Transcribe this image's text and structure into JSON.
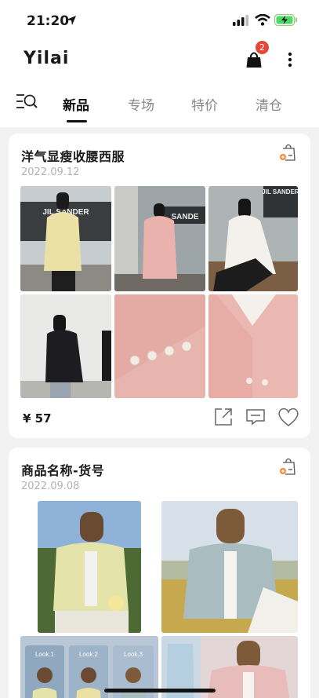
{
  "status": {
    "time": "21:20"
  },
  "app": {
    "title": "Yilai",
    "cart_count": "2"
  },
  "tabs": [
    {
      "label": "新品"
    },
    {
      "label": "专场"
    },
    {
      "label": "特价"
    },
    {
      "label": "清仓"
    }
  ],
  "products": [
    {
      "title": "洋气显瘦收腰西服",
      "date": "2022.09.12",
      "price": "¥ 57"
    },
    {
      "title": "商品名称-货号",
      "date": "2022.09.08"
    }
  ],
  "photo_labels": {
    "store_sign": "JIL SANDER",
    "look1": "Look.1",
    "look2": "Look.2",
    "look3": "Look.3"
  },
  "colors": {
    "accent": "#e5483b",
    "active_tab": "#111111",
    "inactive_tab": "#888888",
    "blazer_pink": "#e8b4ae",
    "blazer_yellow": "#ece1a4"
  }
}
